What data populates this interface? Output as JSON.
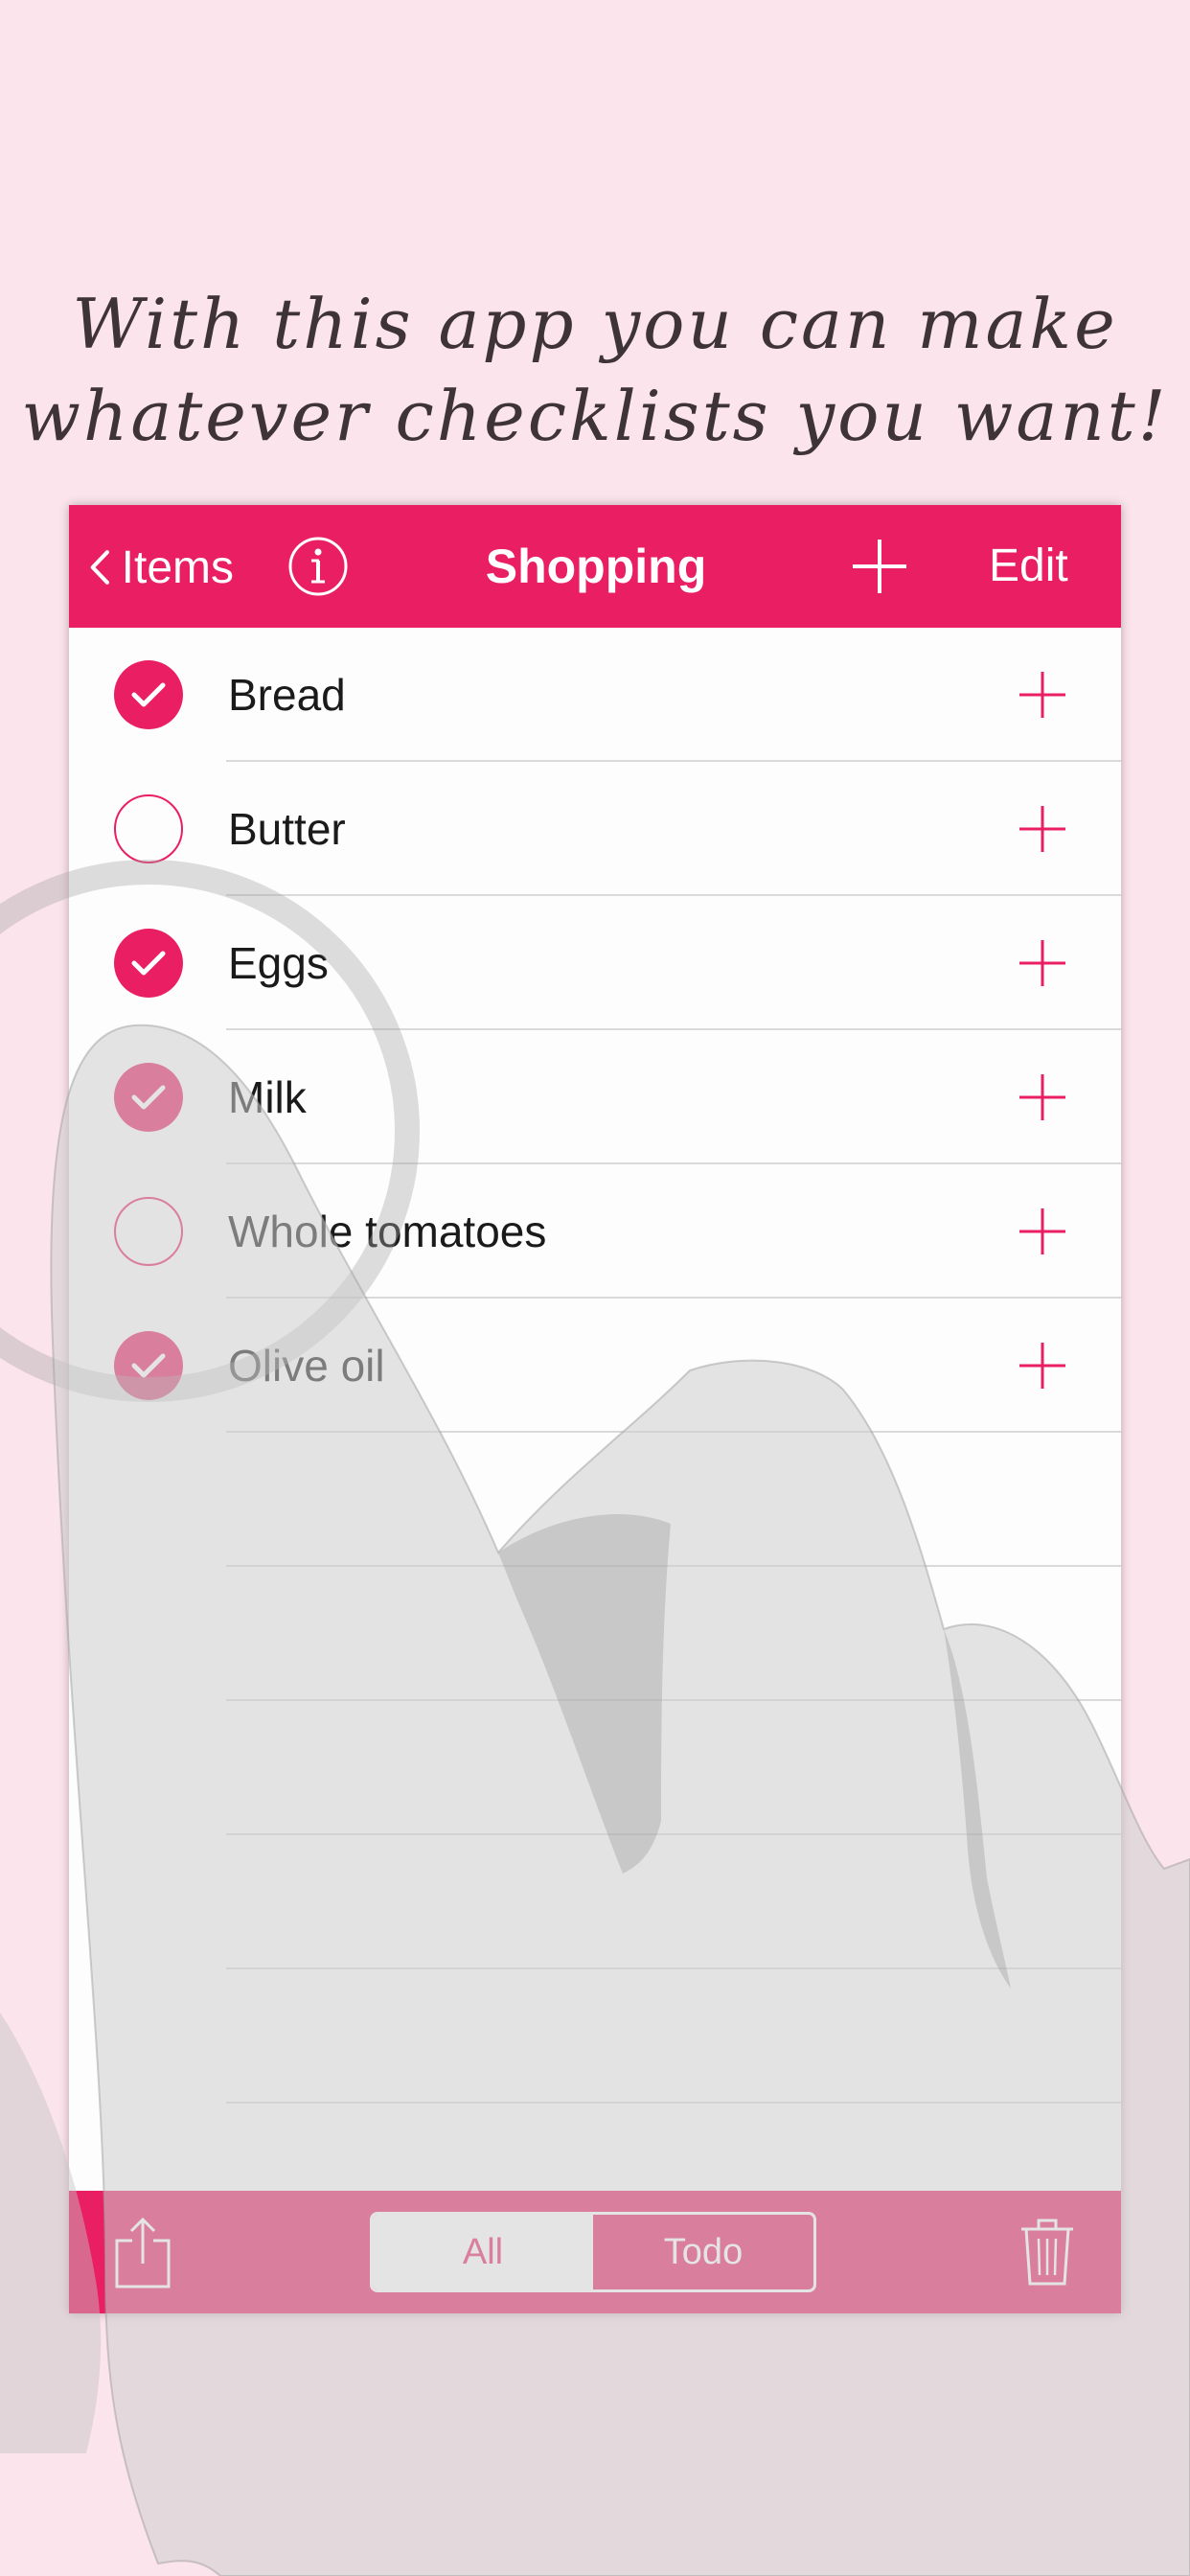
{
  "caption": {
    "line1": "With this app you can make",
    "line2": "whatever checklists you want!"
  },
  "navbar": {
    "back_label": "Items",
    "title": "Shopping",
    "edit_label": "Edit"
  },
  "items": [
    {
      "label": "Bread",
      "checked": true
    },
    {
      "label": "Butter",
      "checked": false
    },
    {
      "label": "Eggs",
      "checked": true
    },
    {
      "label": "Milk",
      "checked": true
    },
    {
      "label": "Whole tomatoes",
      "checked": false
    },
    {
      "label": "Olive oil",
      "checked": true
    }
  ],
  "toolbar": {
    "segments": [
      "All",
      "Todo"
    ],
    "selected": "All"
  },
  "colors": {
    "accent": "#e91e63",
    "background": "#fce4ec"
  },
  "icons": [
    "chevron-left-icon",
    "info-icon",
    "plus-icon",
    "checkmark-icon",
    "share-icon",
    "trash-icon",
    "hand-gesture-icon"
  ]
}
